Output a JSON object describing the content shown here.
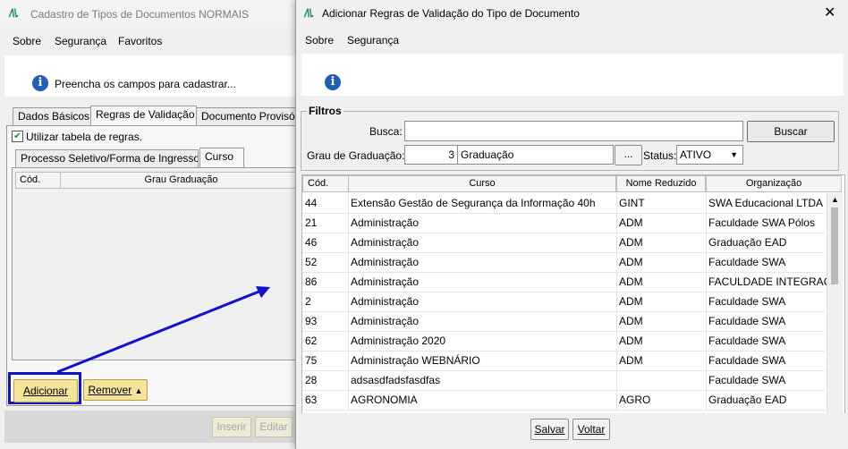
{
  "back_window": {
    "logo": "/\\\\.",
    "title": "Cadastro de Tipos de Documentos NORMAIS",
    "menu": [
      "Sobre",
      "Segurança",
      "Favoritos"
    ],
    "info_text": "Preencha os campos para cadastrar...",
    "tabs": [
      "Dados Básicos",
      "Regras de Validação",
      "Documento Provisó"
    ],
    "checkbox_label": "Utilizar tabela de regras.",
    "subtabs": [
      "Processo Seletivo/Forma de Ingresso",
      "Curso"
    ],
    "columns": [
      "Cód.",
      "Grau Graduação"
    ],
    "add_button": "Adicionar",
    "remove_button": "Remover",
    "insert_button": "Inserir",
    "edit_button": "Editar"
  },
  "front_window": {
    "logo": "/\\\\.",
    "title": "Adicionar Regras de Validação do Tipo de Documento",
    "close_icon": "close-icon",
    "menu": [
      "Sobre",
      "Segurança"
    ],
    "filters_label": "Filtros",
    "busca_label": "Busca:",
    "busca_value": "",
    "buscar_button": "Buscar",
    "grau_label": "Grau de Graduação:",
    "grau_code": "3",
    "grau_name": "Graduação",
    "ellipsis_button": "...",
    "status_label": "Status:",
    "status_value": "ATIVO",
    "columns": [
      "Cód.",
      "Curso",
      "Nome Reduzido",
      "Organização"
    ],
    "rows": [
      [
        "44",
        " Extensão Gestão de Segurança da Informação  40h",
        "GINT",
        "SWA Educacional LTDA"
      ],
      [
        "21",
        "Administração",
        "ADM",
        "Faculdade SWA Pólos"
      ],
      [
        "46",
        "Administração",
        "ADM",
        "Graduação EAD"
      ],
      [
        "52",
        "Administração",
        "ADM",
        "Faculdade SWA"
      ],
      [
        "86",
        "Administração",
        "ADM",
        "FACULDADE INTEGRAÇÃ"
      ],
      [
        "2",
        "Administração",
        "ADM",
        "Faculdade SWA"
      ],
      [
        "93",
        "Administração",
        "ADM",
        "Faculdade SWA"
      ],
      [
        "62",
        "Administração 2020",
        "ADM",
        "Faculdade SWA"
      ],
      [
        "75",
        "Administração WEBNÁRIO",
        "ADM",
        "Faculdade SWA"
      ],
      [
        "28",
        "adsasdfadsfasdfas",
        "",
        "Faculdade SWA"
      ],
      [
        "63",
        "AGRONOMIA",
        "AGRO",
        "Graduação EAD"
      ]
    ],
    "save_button": "Salvar",
    "back_button": "Voltar"
  },
  "colors": {
    "highlight_box": "#1010d0",
    "arrow": "#1010d0",
    "yellow_button": "#f4e49a"
  }
}
